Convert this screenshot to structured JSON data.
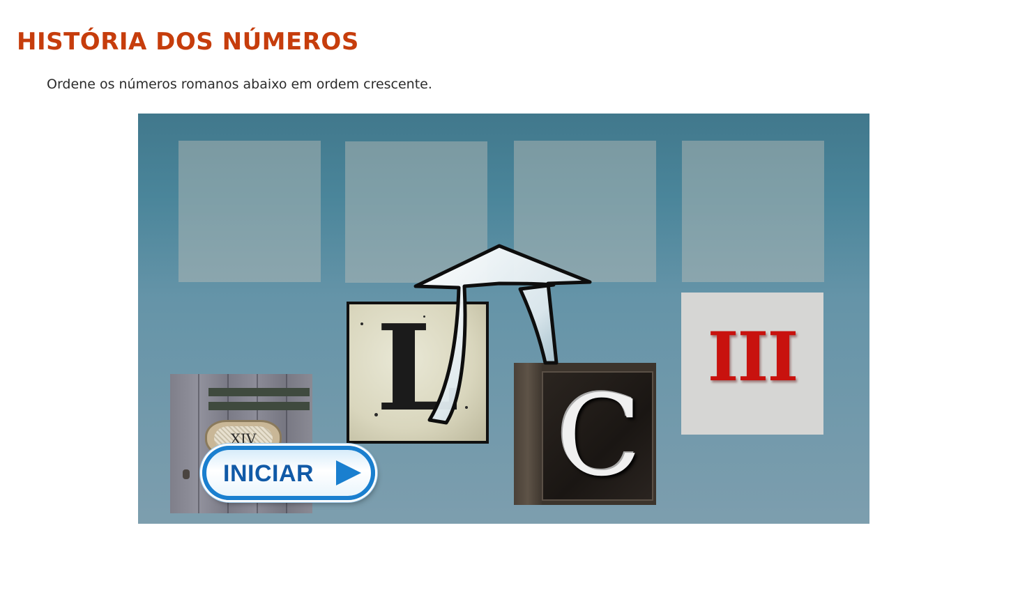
{
  "page": {
    "title": "HISTÓRIA DOS NÚMEROS",
    "instruction": "Ordene os números romanos abaixo em ordem crescente."
  },
  "game": {
    "drop_slots": [
      {
        "id": "slot-1"
      },
      {
        "id": "slot-2"
      },
      {
        "id": "slot-3"
      },
      {
        "id": "slot-4"
      }
    ],
    "cards": [
      {
        "id": "card-xiv",
        "numeral": "XIV"
      },
      {
        "id": "card-l",
        "numeral": "L"
      },
      {
        "id": "card-c",
        "numeral": "C"
      },
      {
        "id": "card-iii",
        "numeral": "III"
      }
    ],
    "start_button": {
      "label": "INICIAR",
      "icon": "play-icon"
    },
    "hint_icon": "curved-arrow-up-icon"
  },
  "colors": {
    "title": "#c63d0c",
    "instruction_text": "#2b2b2b",
    "stage_top": "#41788c",
    "stage_bottom": "#7d9eae",
    "numeral_iii": "#c8120e",
    "button_border": "#1a7fcf",
    "button_text": "#115aa7"
  }
}
